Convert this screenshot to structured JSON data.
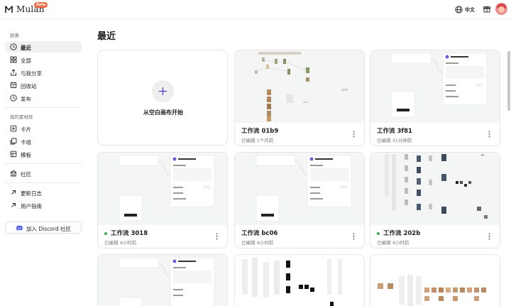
{
  "header": {
    "app_name": "Mulan",
    "badge": "Beta",
    "language": "中文",
    "brand_color": "#f26a45"
  },
  "sidebar": {
    "workspace_label": "創意",
    "workspace_items": [
      {
        "label": "最近",
        "icon": "clock-icon",
        "active": true
      },
      {
        "label": "全部",
        "icon": "grid-icon",
        "active": false
      },
      {
        "label": "与我分享",
        "icon": "share-icon",
        "active": false
      },
      {
        "label": "回收站",
        "icon": "trash-icon",
        "active": false
      },
      {
        "label": "发布",
        "icon": "publish-icon",
        "active": false
      }
    ],
    "materials_label": "我的素材库",
    "material_items": [
      {
        "label": "卡片",
        "icon": "card-icon"
      },
      {
        "label": "卡组",
        "icon": "deck-icon"
      },
      {
        "label": "模板",
        "icon": "template-icon"
      }
    ],
    "community_label": "社区",
    "link_items": [
      {
        "label": "更新日志",
        "icon": "arrow-up-right-icon"
      },
      {
        "label": "用户指南",
        "icon": "arrow-up-right-icon"
      }
    ],
    "discord_label": "加入 Discord 社区"
  },
  "main": {
    "title": "最近",
    "new_card_label": "从空白画布开始",
    "cards": [
      {
        "title": "工作流 01b9",
        "subtitle": "已编辑 1个月前",
        "status_dot": false
      },
      {
        "title": "工作流 3f81",
        "subtitle": "已编辑 31分钟前",
        "status_dot": false
      },
      {
        "title": "工作流 3018",
        "subtitle": "已编辑 4小时前",
        "status_dot": true
      },
      {
        "title": "工作流 bc06",
        "subtitle": "已编辑 4小时前",
        "status_dot": false
      },
      {
        "title": "工作流 202b",
        "subtitle": "已编辑 4小时前",
        "status_dot": true
      }
    ]
  }
}
